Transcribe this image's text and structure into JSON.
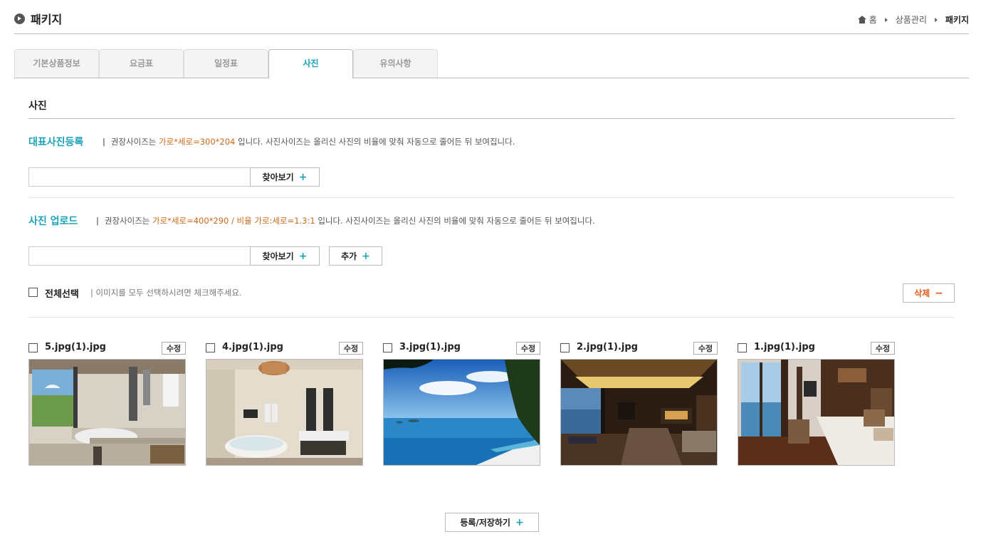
{
  "header": {
    "title": "패키지",
    "breadcrumb": {
      "home": "홈",
      "level1": "상품관리",
      "current": "패키지"
    }
  },
  "tabs": [
    {
      "label": "기본상품정보",
      "active": false
    },
    {
      "label": "요금표",
      "active": false
    },
    {
      "label": "일정표",
      "active": false
    },
    {
      "label": "사진",
      "active": true
    },
    {
      "label": "유의사항",
      "active": false
    }
  ],
  "section": {
    "title": "사진"
  },
  "main_photo": {
    "label": "대표사진등록",
    "desc_pre": "권장사이즈는 ",
    "desc_size": "가로*세로=300*204",
    "desc_post": " 입니다. 사진사이즈는 올리신 사진의 비율에 맞춰 자동으로 줄어든 뒤 보여집니다.",
    "file_value": "",
    "browse_label": "찾아보기"
  },
  "upload": {
    "label": "사진 업로드",
    "desc_pre": "권장사이즈는 ",
    "desc_size": "가로*세로=400*290 / 비율 가로:세로=1.3:1",
    "desc_post": " 입니다. 사진사이즈는 올리신 사진의 비율에 맞춰 자동으로 줄어든 뒤 보여집니다.",
    "file_value": "",
    "browse_label": "찾아보기",
    "add_label": "추가"
  },
  "select_all": {
    "label": "전체선택",
    "desc": "| 이미지를 모두 선택하시려면 체크해주세요.",
    "delete_label": "삭제"
  },
  "photos": [
    {
      "name": "5.jpg(1).jpg",
      "edit_label": "수정",
      "scene": "bathroom-pool"
    },
    {
      "name": "4.jpg(1).jpg",
      "edit_label": "수정",
      "scene": "bathroom-tub"
    },
    {
      "name": "3.jpg(1).jpg",
      "edit_label": "수정",
      "scene": "ocean-view"
    },
    {
      "name": "2.jpg(1).jpg",
      "edit_label": "수정",
      "scene": "villa-living"
    },
    {
      "name": "1.jpg(1).jpg",
      "edit_label": "수정",
      "scene": "villa-bedroom"
    }
  ],
  "footer": {
    "save_label": "등록/저장하기"
  },
  "colors": {
    "accent": "#1aa3b8",
    "highlight": "#c86a1a",
    "danger": "#e05a1a"
  }
}
